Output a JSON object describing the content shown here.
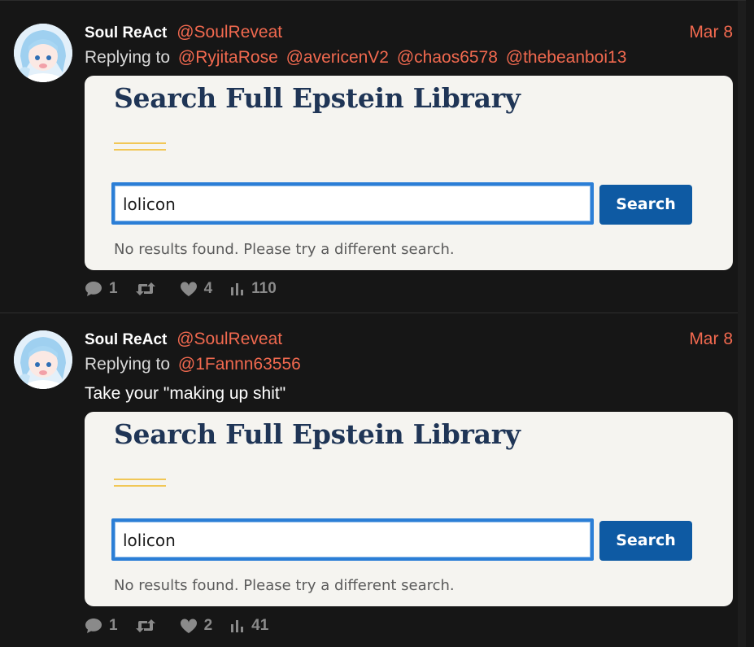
{
  "colors": {
    "accent": "#f1694f",
    "background": "#161616",
    "search_button": "#0e5aa3",
    "library_title": "#1f3556",
    "focus_border": "#2b7ed6"
  },
  "tweets": [
    {
      "display_name": "Soul ReAct",
      "handle": "@SoulReveat",
      "date": "Mar 8",
      "replying_prefix": "Replying to",
      "mentions": [
        "@RyjitaRose",
        "@avericenV2",
        "@chaos6578",
        "@thebeanboi13"
      ],
      "text": "",
      "media": {
        "title": "Search Full Epstein Library",
        "search_value": "lolicon",
        "search_button": "Search",
        "no_results": "No results found. Please try a different search."
      },
      "stats": {
        "replies": "1",
        "likes": "4",
        "views": "110"
      }
    },
    {
      "display_name": "Soul ReAct",
      "handle": "@SoulReveat",
      "date": "Mar 8",
      "replying_prefix": "Replying to",
      "mentions": [
        "@1Fannn63556"
      ],
      "text": "Take your \"making up shit\"",
      "media": {
        "title": "Search Full Epstein Library",
        "search_value": "lolicon",
        "search_button": "Search",
        "no_results": "No results found. Please try a different search."
      },
      "stats": {
        "replies": "1",
        "likes": "2",
        "views": "41"
      }
    }
  ],
  "icons": {
    "reply": "speech-bubble-icon",
    "retweet": "retweet-icon",
    "like": "heart-icon",
    "views": "bar-chart-icon"
  }
}
